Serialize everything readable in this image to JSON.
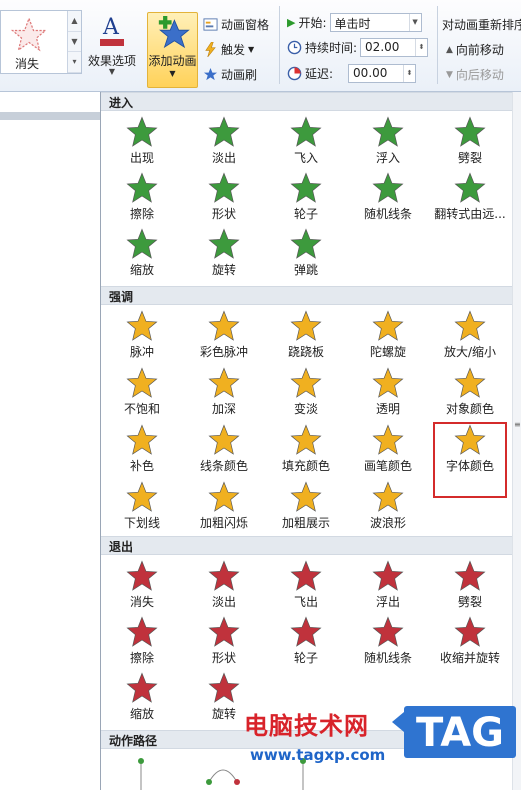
{
  "ribbon": {
    "gallery_label": "消失",
    "effect_options": "效果选项",
    "add_animation": "添加动画",
    "anim_pane": "动画窗格",
    "trigger": "触发",
    "anim_painter": "动画刷",
    "start_label": "开始:",
    "start_value": "单击时",
    "duration_label": "持续时间:",
    "duration_value": "02.00",
    "delay_label": "延迟:",
    "delay_value": "00.00",
    "reorder_title": "对动画重新排序",
    "move_earlier": "向前移动",
    "move_later": "向后移动"
  },
  "panel": {
    "entrance": {
      "title": "进入",
      "items": [
        "出现",
        "淡出",
        "飞入",
        "浮入",
        "劈裂",
        "擦除",
        "形状",
        "轮子",
        "随机线条",
        "翻转式由远...",
        "缩放",
        "旋转",
        "弹跳"
      ]
    },
    "emphasis": {
      "title": "强调",
      "items": [
        "脉冲",
        "彩色脉冲",
        "跷跷板",
        "陀螺旋",
        "放大/缩小",
        "不饱和",
        "加深",
        "变淡",
        "透明",
        "对象颜色",
        "补色",
        "线条颜色",
        "填充颜色",
        "画笔颜色",
        "字体颜色",
        "下划线",
        "加粗闪烁",
        "加粗展示",
        "波浪形"
      ]
    },
    "exit": {
      "title": "退出",
      "items": [
        "消失",
        "淡出",
        "飞出",
        "浮出",
        "劈裂",
        "擦除",
        "形状",
        "轮子",
        "随机线条",
        "收缩并旋转",
        "缩放",
        "旋转"
      ]
    },
    "paths": {
      "title": "动作路径"
    }
  },
  "watermark": {
    "site_name": "电脑技术网",
    "url": "www.tagxp.com",
    "tag": "TAG"
  },
  "colors": {
    "entrance": "#3d9a3d",
    "emphasis": "#f0b020",
    "exit": "#c0323c",
    "highlight": "#d42b2b",
    "accent": "#2f74d0"
  }
}
